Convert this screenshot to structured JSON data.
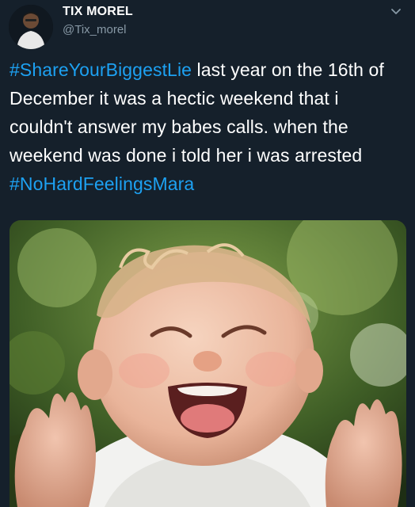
{
  "tweet": {
    "display_name": "TIX MOREL",
    "handle": "@Tix_morel",
    "text_segments": [
      {
        "type": "hashtag",
        "text": "#ShareYourBiggestLie"
      },
      {
        "type": "text",
        "text": " last year on the 16th of December it was a hectic weekend that i couldn't answer my babes calls. when the weekend was done i told her i was arrested "
      },
      {
        "type": "hashtag",
        "text": "#NoHardFeelingsMara"
      }
    ],
    "menu_icon": "chevron-down-icon"
  },
  "media": {
    "subject": "laughing-baby-photo"
  },
  "colors": {
    "background": "#15202b",
    "text": "#ffffff",
    "secondary": "#8899a6",
    "hashtag": "#1da1f2"
  }
}
